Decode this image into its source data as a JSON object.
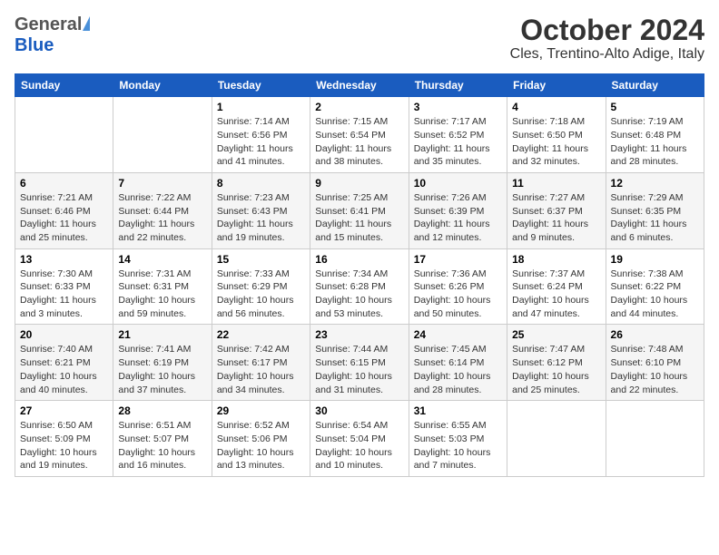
{
  "header": {
    "logo_general": "General",
    "logo_blue": "Blue",
    "title": "October 2024",
    "subtitle": "Cles, Trentino-Alto Adige, Italy"
  },
  "weekdays": [
    "Sunday",
    "Monday",
    "Tuesday",
    "Wednesday",
    "Thursday",
    "Friday",
    "Saturday"
  ],
  "weeks": [
    [
      {
        "day": "",
        "info": ""
      },
      {
        "day": "",
        "info": ""
      },
      {
        "day": "1",
        "info": "Sunrise: 7:14 AM\nSunset: 6:56 PM\nDaylight: 11 hours and 41 minutes."
      },
      {
        "day": "2",
        "info": "Sunrise: 7:15 AM\nSunset: 6:54 PM\nDaylight: 11 hours and 38 minutes."
      },
      {
        "day": "3",
        "info": "Sunrise: 7:17 AM\nSunset: 6:52 PM\nDaylight: 11 hours and 35 minutes."
      },
      {
        "day": "4",
        "info": "Sunrise: 7:18 AM\nSunset: 6:50 PM\nDaylight: 11 hours and 32 minutes."
      },
      {
        "day": "5",
        "info": "Sunrise: 7:19 AM\nSunset: 6:48 PM\nDaylight: 11 hours and 28 minutes."
      }
    ],
    [
      {
        "day": "6",
        "info": "Sunrise: 7:21 AM\nSunset: 6:46 PM\nDaylight: 11 hours and 25 minutes."
      },
      {
        "day": "7",
        "info": "Sunrise: 7:22 AM\nSunset: 6:44 PM\nDaylight: 11 hours and 22 minutes."
      },
      {
        "day": "8",
        "info": "Sunrise: 7:23 AM\nSunset: 6:43 PM\nDaylight: 11 hours and 19 minutes."
      },
      {
        "day": "9",
        "info": "Sunrise: 7:25 AM\nSunset: 6:41 PM\nDaylight: 11 hours and 15 minutes."
      },
      {
        "day": "10",
        "info": "Sunrise: 7:26 AM\nSunset: 6:39 PM\nDaylight: 11 hours and 12 minutes."
      },
      {
        "day": "11",
        "info": "Sunrise: 7:27 AM\nSunset: 6:37 PM\nDaylight: 11 hours and 9 minutes."
      },
      {
        "day": "12",
        "info": "Sunrise: 7:29 AM\nSunset: 6:35 PM\nDaylight: 11 hours and 6 minutes."
      }
    ],
    [
      {
        "day": "13",
        "info": "Sunrise: 7:30 AM\nSunset: 6:33 PM\nDaylight: 11 hours and 3 minutes."
      },
      {
        "day": "14",
        "info": "Sunrise: 7:31 AM\nSunset: 6:31 PM\nDaylight: 10 hours and 59 minutes."
      },
      {
        "day": "15",
        "info": "Sunrise: 7:33 AM\nSunset: 6:29 PM\nDaylight: 10 hours and 56 minutes."
      },
      {
        "day": "16",
        "info": "Sunrise: 7:34 AM\nSunset: 6:28 PM\nDaylight: 10 hours and 53 minutes."
      },
      {
        "day": "17",
        "info": "Sunrise: 7:36 AM\nSunset: 6:26 PM\nDaylight: 10 hours and 50 minutes."
      },
      {
        "day": "18",
        "info": "Sunrise: 7:37 AM\nSunset: 6:24 PM\nDaylight: 10 hours and 47 minutes."
      },
      {
        "day": "19",
        "info": "Sunrise: 7:38 AM\nSunset: 6:22 PM\nDaylight: 10 hours and 44 minutes."
      }
    ],
    [
      {
        "day": "20",
        "info": "Sunrise: 7:40 AM\nSunset: 6:21 PM\nDaylight: 10 hours and 40 minutes."
      },
      {
        "day": "21",
        "info": "Sunrise: 7:41 AM\nSunset: 6:19 PM\nDaylight: 10 hours and 37 minutes."
      },
      {
        "day": "22",
        "info": "Sunrise: 7:42 AM\nSunset: 6:17 PM\nDaylight: 10 hours and 34 minutes."
      },
      {
        "day": "23",
        "info": "Sunrise: 7:44 AM\nSunset: 6:15 PM\nDaylight: 10 hours and 31 minutes."
      },
      {
        "day": "24",
        "info": "Sunrise: 7:45 AM\nSunset: 6:14 PM\nDaylight: 10 hours and 28 minutes."
      },
      {
        "day": "25",
        "info": "Sunrise: 7:47 AM\nSunset: 6:12 PM\nDaylight: 10 hours and 25 minutes."
      },
      {
        "day": "26",
        "info": "Sunrise: 7:48 AM\nSunset: 6:10 PM\nDaylight: 10 hours and 22 minutes."
      }
    ],
    [
      {
        "day": "27",
        "info": "Sunrise: 6:50 AM\nSunset: 5:09 PM\nDaylight: 10 hours and 19 minutes."
      },
      {
        "day": "28",
        "info": "Sunrise: 6:51 AM\nSunset: 5:07 PM\nDaylight: 10 hours and 16 minutes."
      },
      {
        "day": "29",
        "info": "Sunrise: 6:52 AM\nSunset: 5:06 PM\nDaylight: 10 hours and 13 minutes."
      },
      {
        "day": "30",
        "info": "Sunrise: 6:54 AM\nSunset: 5:04 PM\nDaylight: 10 hours and 10 minutes."
      },
      {
        "day": "31",
        "info": "Sunrise: 6:55 AM\nSunset: 5:03 PM\nDaylight: 10 hours and 7 minutes."
      },
      {
        "day": "",
        "info": ""
      },
      {
        "day": "",
        "info": ""
      }
    ]
  ]
}
